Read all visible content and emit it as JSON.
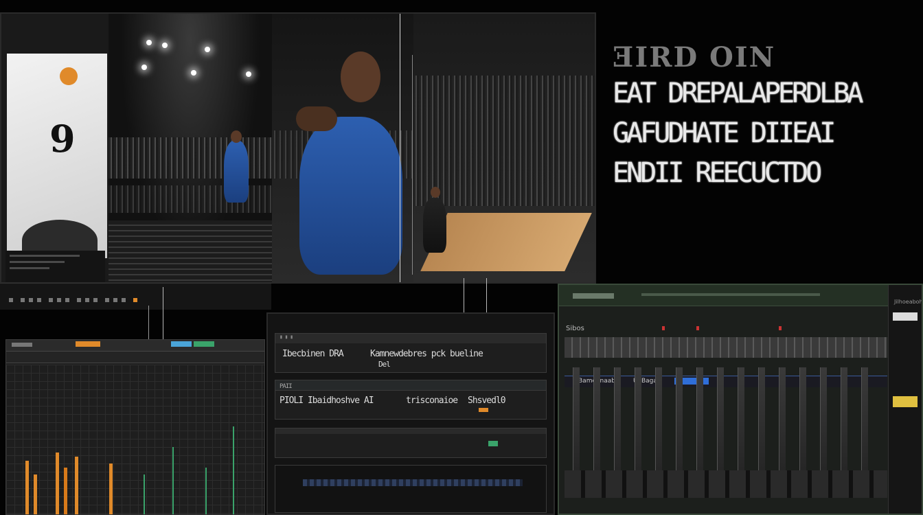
{
  "overlay_text": {
    "logo": "ƎIRD OIN",
    "line1": "EAT DREPALAPERDLBA",
    "line2": "GAFUDHATE DIIEAI",
    "line3": "ENDII REECUCTDO"
  },
  "left_editor": {
    "header": "",
    "tab_colors": [
      "#e08a2a",
      "#4aa4d8",
      "#3aa36a"
    ]
  },
  "console": {
    "row1_left": "Ibecbinen DRA",
    "row1_right": "Kamnewdebres pck bueline",
    "row1_sub": "Del",
    "row2_label": "PAII",
    "row2_left": "PIOLI Ibaidhoshve AI",
    "row2_mid": "trisconaioe",
    "row2_right": "Shsvedl0",
    "row3_label": ""
  },
  "mixer": {
    "label1": "Sibos",
    "label2": "Bameanaab",
    "label3": "Ui Bagab",
    "label4": "Jilhoeabohbe"
  },
  "colors": {
    "accent_orange": "#e08a2a",
    "accent_blue": "#2f6ed8",
    "jersey_blue": "#2d5fb0",
    "court_wood": "#c99a62",
    "mixer_green": "#243024"
  }
}
